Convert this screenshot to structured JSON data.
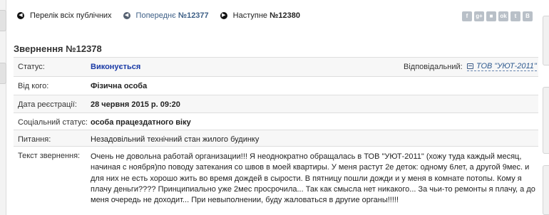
{
  "nav": {
    "list_label": "Перелік всіх публічних",
    "prev_prefix": "Попереднє ",
    "prev_number": "№12377",
    "next_prefix": "Наступне ",
    "next_number": "№12380"
  },
  "share_buttons": [
    "f",
    "g+",
    "■",
    "ok",
    "t",
    "В"
  ],
  "appeal": {
    "title": "Звернення №12378",
    "status_label": "Статус:",
    "status_value": "Виконується",
    "responsible_label": "Відповідальний:",
    "responsible_value": "ТОВ \"УЮТ-2011\"",
    "from_label": "Від кого:",
    "from_value": "Фізична особа",
    "date_label": "Дата реєстрації:",
    "date_value": "28 червня 2015 р. 09:20",
    "social_label": "Соціальний статус:",
    "social_value": "особа працездатного віку",
    "question_label": "Питання:",
    "question_value": "Незадовільний технічний стан жилого будинку",
    "text_label": "Текст звернення:",
    "text_value": "Очень не довольна работай организации!!! Я неоднократно обращалась в ТОВ \"УЮТ-2011\" (хожу туда каждый месяц, начиная с ноября)по поводу затекания со швов в моей квартиры. У меня растут 2е деток: одному 6лет, а другой 9мес. и для них не есть хорошо жить во время дождей в сырости. В пятницу пошли дожди и у меня в комнате потопы. Кому я плачу деньги???? Принципиально уже 2мес просрочила... Так как смысла нет никакого... За чьи-то ремонты я плачу, а до меня очередь не доходит... При невыполнении, буду жаловаться в другие органы!!!!!"
  },
  "colors": {
    "status": "#1a3aa6",
    "link": "#2f5a8f",
    "row_alt": "#f7f7f7"
  }
}
